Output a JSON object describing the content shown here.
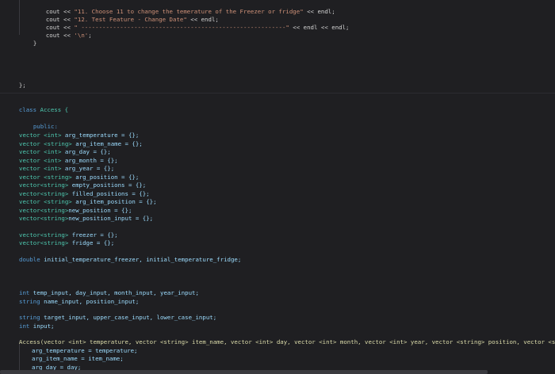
{
  "code": {
    "l1": {
      "a": "cout << ",
      "b": "\"11. Choose 11 to change the temerature of the Freezer or fridge\"",
      "c": " << endl;"
    },
    "l2": {
      "a": "cout << ",
      "b": "\"12. Test Feature - Change Date\"",
      "c": " << endl;"
    },
    "l3": {
      "a": "cout << ",
      "b": "\" ----------------------------------------------------------\"",
      "c": " << endl << endl;"
    },
    "l4": {
      "a": "cout << ",
      "b": "'\\n'",
      "c": ";"
    },
    "l5": "}",
    "l6": "};",
    "l7": {
      "kw": "class",
      "name": " Access {"
    },
    "l8": "public:",
    "vars1": [
      {
        "t": "vector <int>",
        "n": " arg_temperature = {};"
      },
      {
        "t": "vector <string>",
        "n": " arg_item_name = {};"
      },
      {
        "t": "vector <int>",
        "n": " arg_day = {};"
      },
      {
        "t": "vector <int>",
        "n": " arg_month = {};"
      },
      {
        "t": "vector <int>",
        "n": " arg_year = {};"
      },
      {
        "t": "vector <string>",
        "n": " arg_position = {};"
      },
      {
        "t": "vector<string>",
        "n": " empty_positions = {};"
      },
      {
        "t": "vector<string>",
        "n": " filled_positions = {};"
      },
      {
        "t": "vector <string>",
        "n": " arg_item_position = {};"
      },
      {
        "t": "vector<string>",
        "n": "new_position = {};"
      },
      {
        "t": "vector<string>",
        "n": "new_position_input = {};"
      }
    ],
    "vars2": [
      {
        "t": "vector<string>",
        "n": " freezer = {};"
      },
      {
        "t": "vector<string>",
        "n": " fridge = {};"
      }
    ],
    "dbl": {
      "t": "double",
      "n": " initial_temperature_freezer, initial_temperature_fridge;"
    },
    "ints": {
      "t": "int",
      "n": " temp_input, day_input, month_input, year_input;"
    },
    "strs": {
      "t": "string",
      "n": " name_input, position_input;"
    },
    "strs2": {
      "t": "string",
      "n": " target_input, upper_case_input, lower_case_input;"
    },
    "int2": {
      "t": "int",
      "n": " input;"
    },
    "ctor": "Access(vector <int> temperature, vector <string> item_name, vector <int> day, vector <int> month, vector <int> year, vector <string> position, vector <string> it",
    "body1": "arg_temperature = temperature;",
    "body2": "arg_item_name = item_name;",
    "body3": "arg_day = day;"
  }
}
